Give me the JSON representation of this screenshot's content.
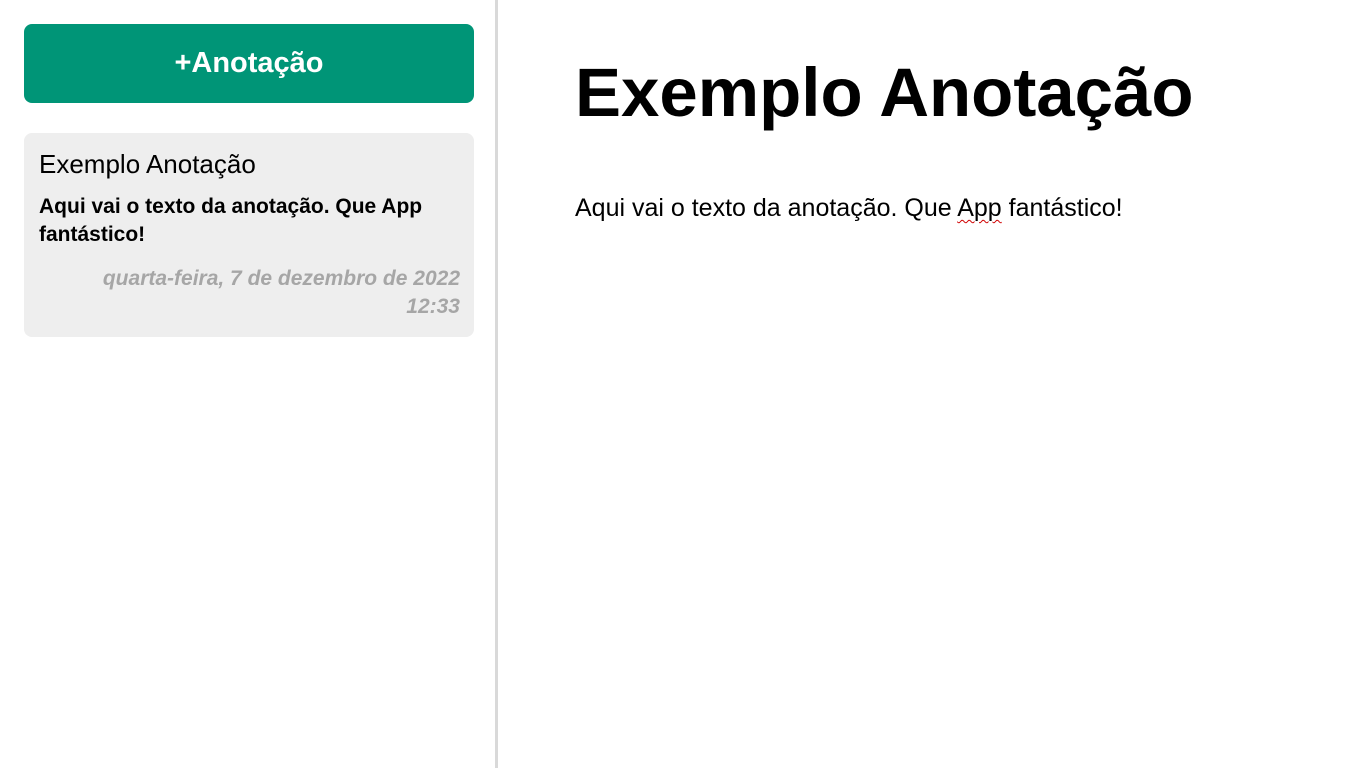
{
  "sidebar": {
    "add_button_label": "+Anotação",
    "notes": [
      {
        "title": "Exemplo Anotação",
        "preview": "Aqui vai o texto da anotação. Que App fantástico!",
        "date_line1": "quarta-feira, 7 de dezembro de 2022",
        "date_line2": "12:33"
      }
    ]
  },
  "main": {
    "title": "Exemplo Anotação",
    "body_before": "Aqui vai o texto da anotação. Que ",
    "body_misspelled": "App",
    "body_after": " fantástico!"
  },
  "colors": {
    "accent": "#009577",
    "card_background": "#eeeeee",
    "date_text": "#a6a6a6",
    "divider": "#d9d9d9",
    "spellcheck_underline": "#d00000"
  }
}
